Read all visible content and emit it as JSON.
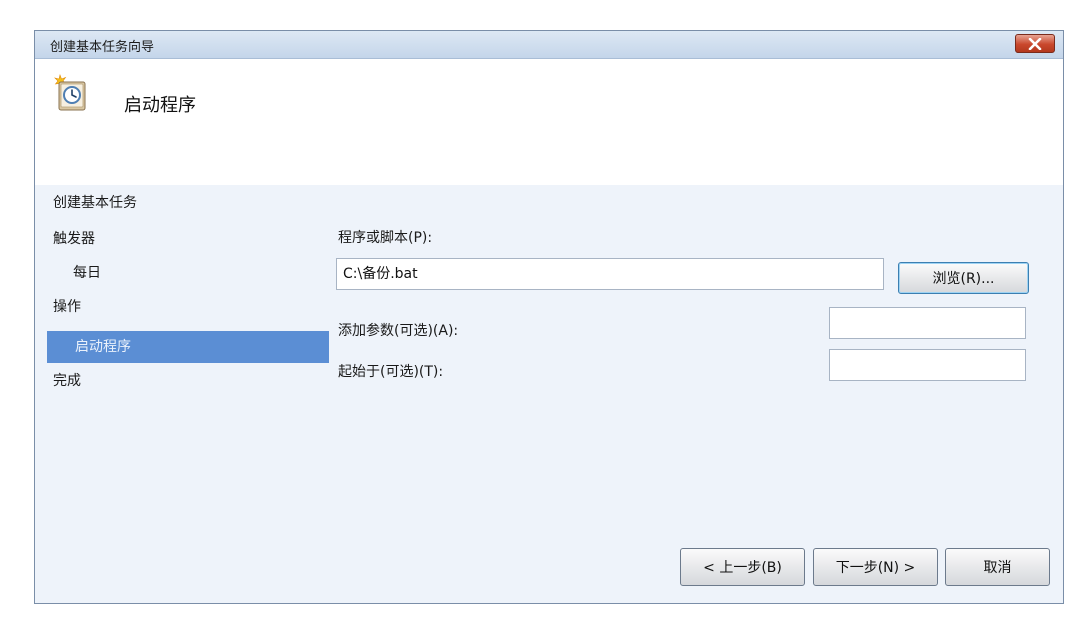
{
  "window": {
    "title": "创建基本任务向导",
    "close_icon": "close-icon"
  },
  "header": {
    "title": "启动程序",
    "icon": "task-scheduler-clock-icon"
  },
  "sidebar": {
    "items": [
      {
        "label": "创建基本任务"
      },
      {
        "label": "触发器"
      },
      {
        "label": "每日"
      },
      {
        "label": "操作"
      },
      {
        "label": "启动程序"
      },
      {
        "label": "完成"
      }
    ]
  },
  "form": {
    "program_label": "程序或脚本(P):",
    "program_value": "C:\\备份.bat",
    "browse_label": "浏览(R)...",
    "args_label": "添加参数(可选)(A):",
    "args_value": "",
    "startin_label": "起始于(可选)(T):",
    "startin_value": ""
  },
  "footer": {
    "back_label": "< 上一步(B)",
    "next_label": "下一步(N) >",
    "cancel_label": "取消"
  },
  "colors": {
    "selected": "#5b8ed4",
    "close": "#c9472c",
    "window_bg": "#eef3fa"
  }
}
